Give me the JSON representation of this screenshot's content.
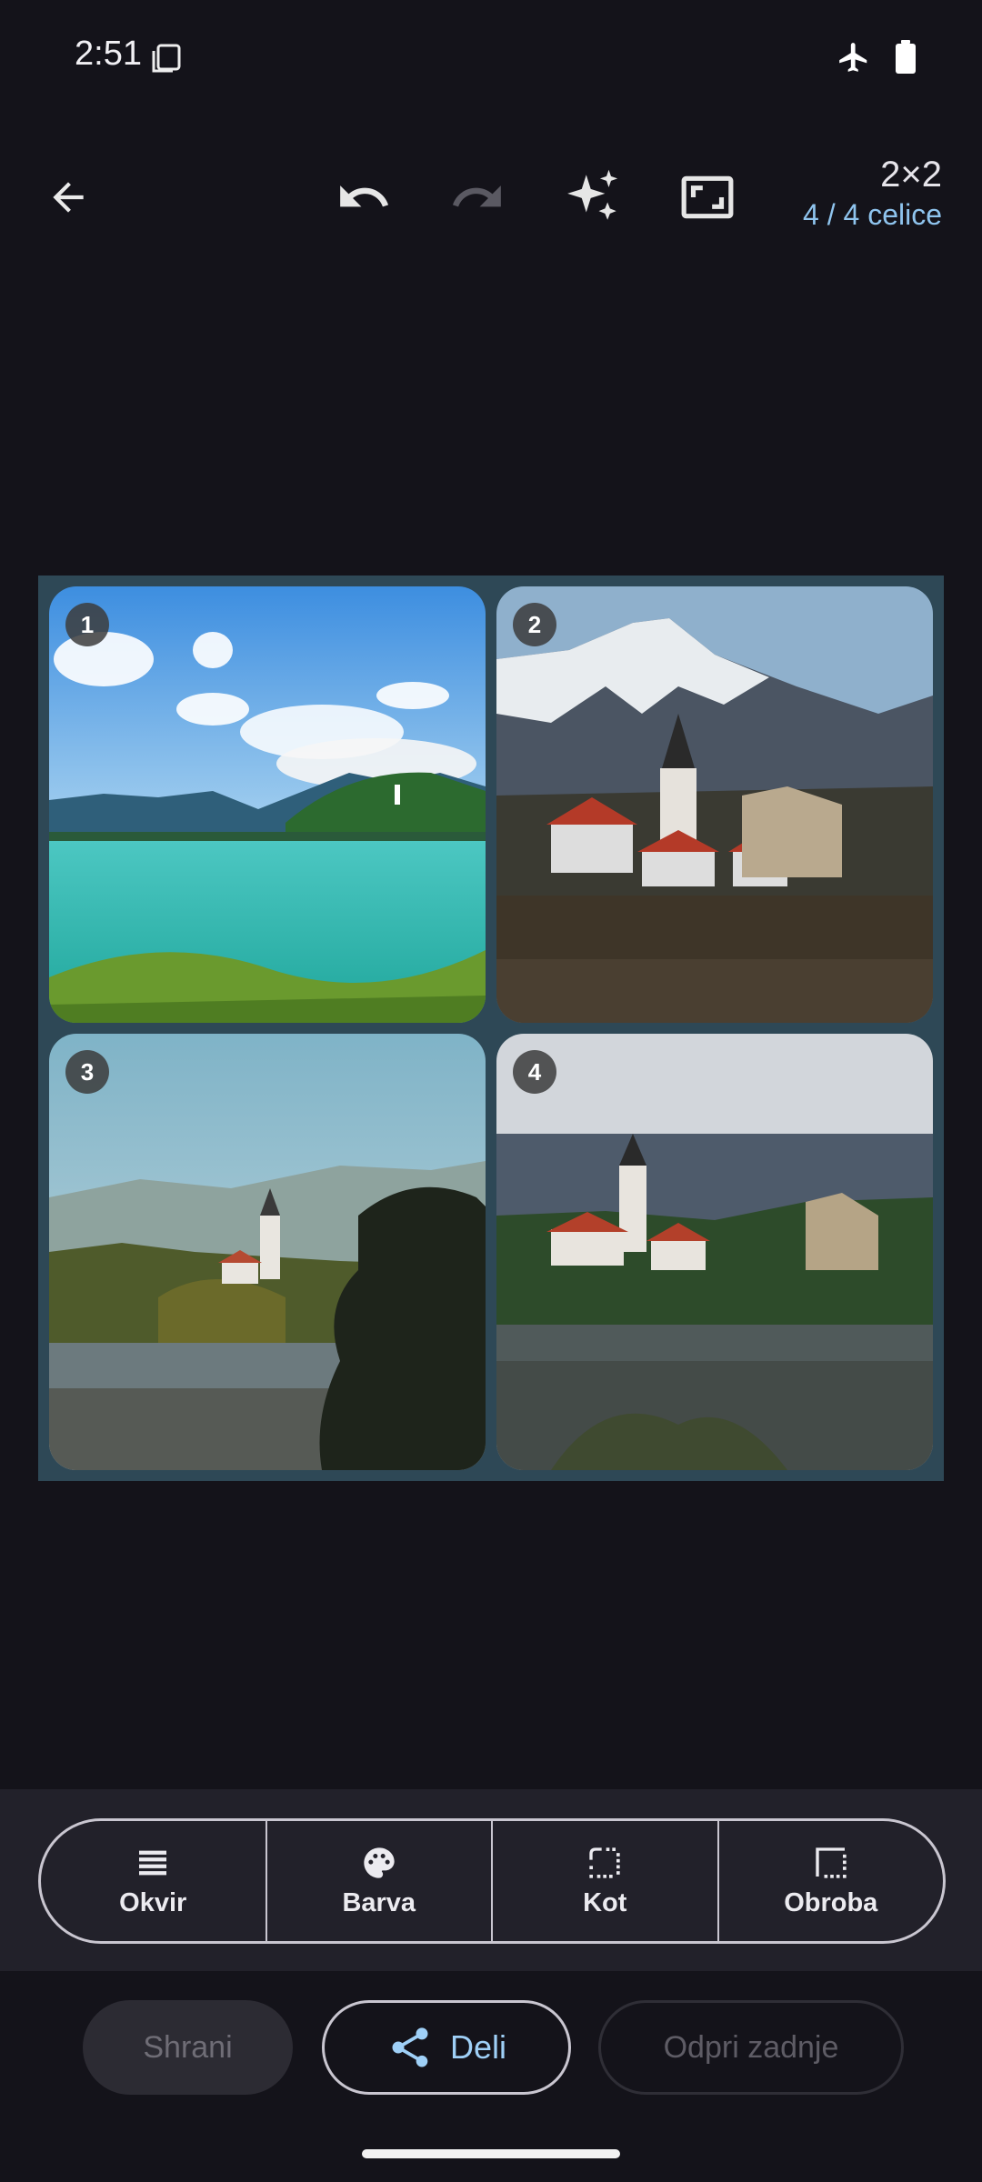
{
  "status": {
    "time": "2:51"
  },
  "toolbar": {
    "back_icon": "arrow-left-icon",
    "undo_icon": "undo-icon",
    "redo_icon": "redo-icon",
    "auto_icon": "sparkles-icon",
    "aspect_icon": "aspect-ratio-icon",
    "grid_size": "2×2",
    "cell_count": "4 / 4 celice"
  },
  "collage": {
    "cells": [
      {
        "number": "1"
      },
      {
        "number": "2"
      },
      {
        "number": "3"
      },
      {
        "number": "4"
      }
    ],
    "background_color": "#2e4856"
  },
  "options": {
    "items": [
      {
        "label": "Okvir",
        "icon": "layout-lines-icon"
      },
      {
        "label": "Barva",
        "icon": "palette-icon"
      },
      {
        "label": "Kot",
        "icon": "corner-icon"
      },
      {
        "label": "Obroba",
        "icon": "border-icon"
      }
    ]
  },
  "actions": {
    "save_label": "Shrani",
    "share_label": "Deli",
    "open_last_label": "Odpri zadnje"
  }
}
